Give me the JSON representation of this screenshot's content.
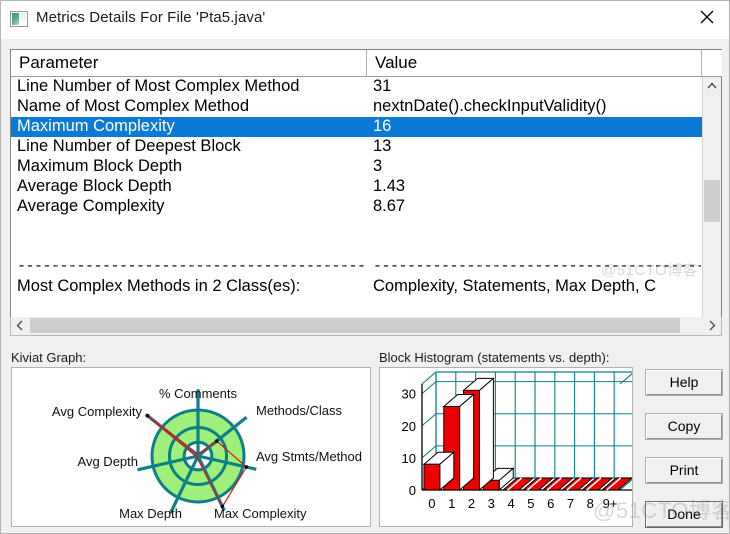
{
  "window": {
    "title": "Metrics Details For File 'Pta5.java'",
    "icon": "image-icon",
    "close_label": "close-icon"
  },
  "table": {
    "columns": [
      "Parameter",
      "Value"
    ],
    "rows": [
      {
        "parameter": "Line Number of Most Complex Method",
        "value": "31",
        "selected": false
      },
      {
        "parameter": "Name of Most Complex Method",
        "value": "nextnDate().checkInputValidity()",
        "selected": false
      },
      {
        "parameter": "Maximum Complexity",
        "value": "16",
        "selected": true
      },
      {
        "parameter": "Line Number of Deepest Block",
        "value": "13",
        "selected": false
      },
      {
        "parameter": "Maximum Block Depth",
        "value": "3",
        "selected": false
      },
      {
        "parameter": "Average Block Depth",
        "value": "1.43",
        "selected": false
      },
      {
        "parameter": "Average Complexity",
        "value": "8.67",
        "selected": false
      },
      {
        "parameter": "",
        "value": "",
        "selected": false
      },
      {
        "parameter": "",
        "value": "",
        "selected": false
      },
      {
        "parameter": "------------------------------------------------",
        "value": "-----------------------------------------------",
        "selected": false,
        "dashes": true
      },
      {
        "parameter": "Most Complex Methods in 2 Class(es):",
        "value": "Complexity, Statements, Max Depth, C",
        "selected": false
      }
    ]
  },
  "scroll": {
    "up_arrow": "chevron-up-icon",
    "down_arrow": "chevron-down-icon",
    "left_arrow": "chevron-left-icon",
    "right_arrow": "chevron-right-icon"
  },
  "kiviat": {
    "label": "Kiviat Graph:",
    "axes": [
      "% Comments",
      "Methods/Class",
      "Avg Stmts/Method",
      "Max Complexity",
      "Max Depth",
      "Avg Depth",
      "Avg Complexity"
    ],
    "fill_color": "#9ef07a",
    "spoke_color": "#0f7f87",
    "polygon_color": "#e81010"
  },
  "histogram": {
    "label": "Block Histogram (statements vs. depth):"
  },
  "chart_data": {
    "type": "bar",
    "title": "Block Histogram (statements vs. depth)",
    "xlabel": "",
    "ylabel": "",
    "categories": [
      "0",
      "1",
      "2",
      "3",
      "4",
      "5",
      "6",
      "7",
      "8",
      "9+"
    ],
    "values": [
      8,
      26,
      31,
      3,
      0,
      0,
      0,
      0,
      0,
      0
    ],
    "yticks": [
      0,
      10,
      20,
      30
    ],
    "ylim": [
      0,
      33
    ],
    "grid": true,
    "bar_color": "#ee0000",
    "grid_color": "#0f7f87",
    "legend": "none"
  },
  "buttons": {
    "help": "Help",
    "copy": "Copy",
    "print": "Print",
    "done": "Done"
  },
  "watermarks": {
    "small": "@51CTO博客",
    "large": "@51CTO博客"
  }
}
